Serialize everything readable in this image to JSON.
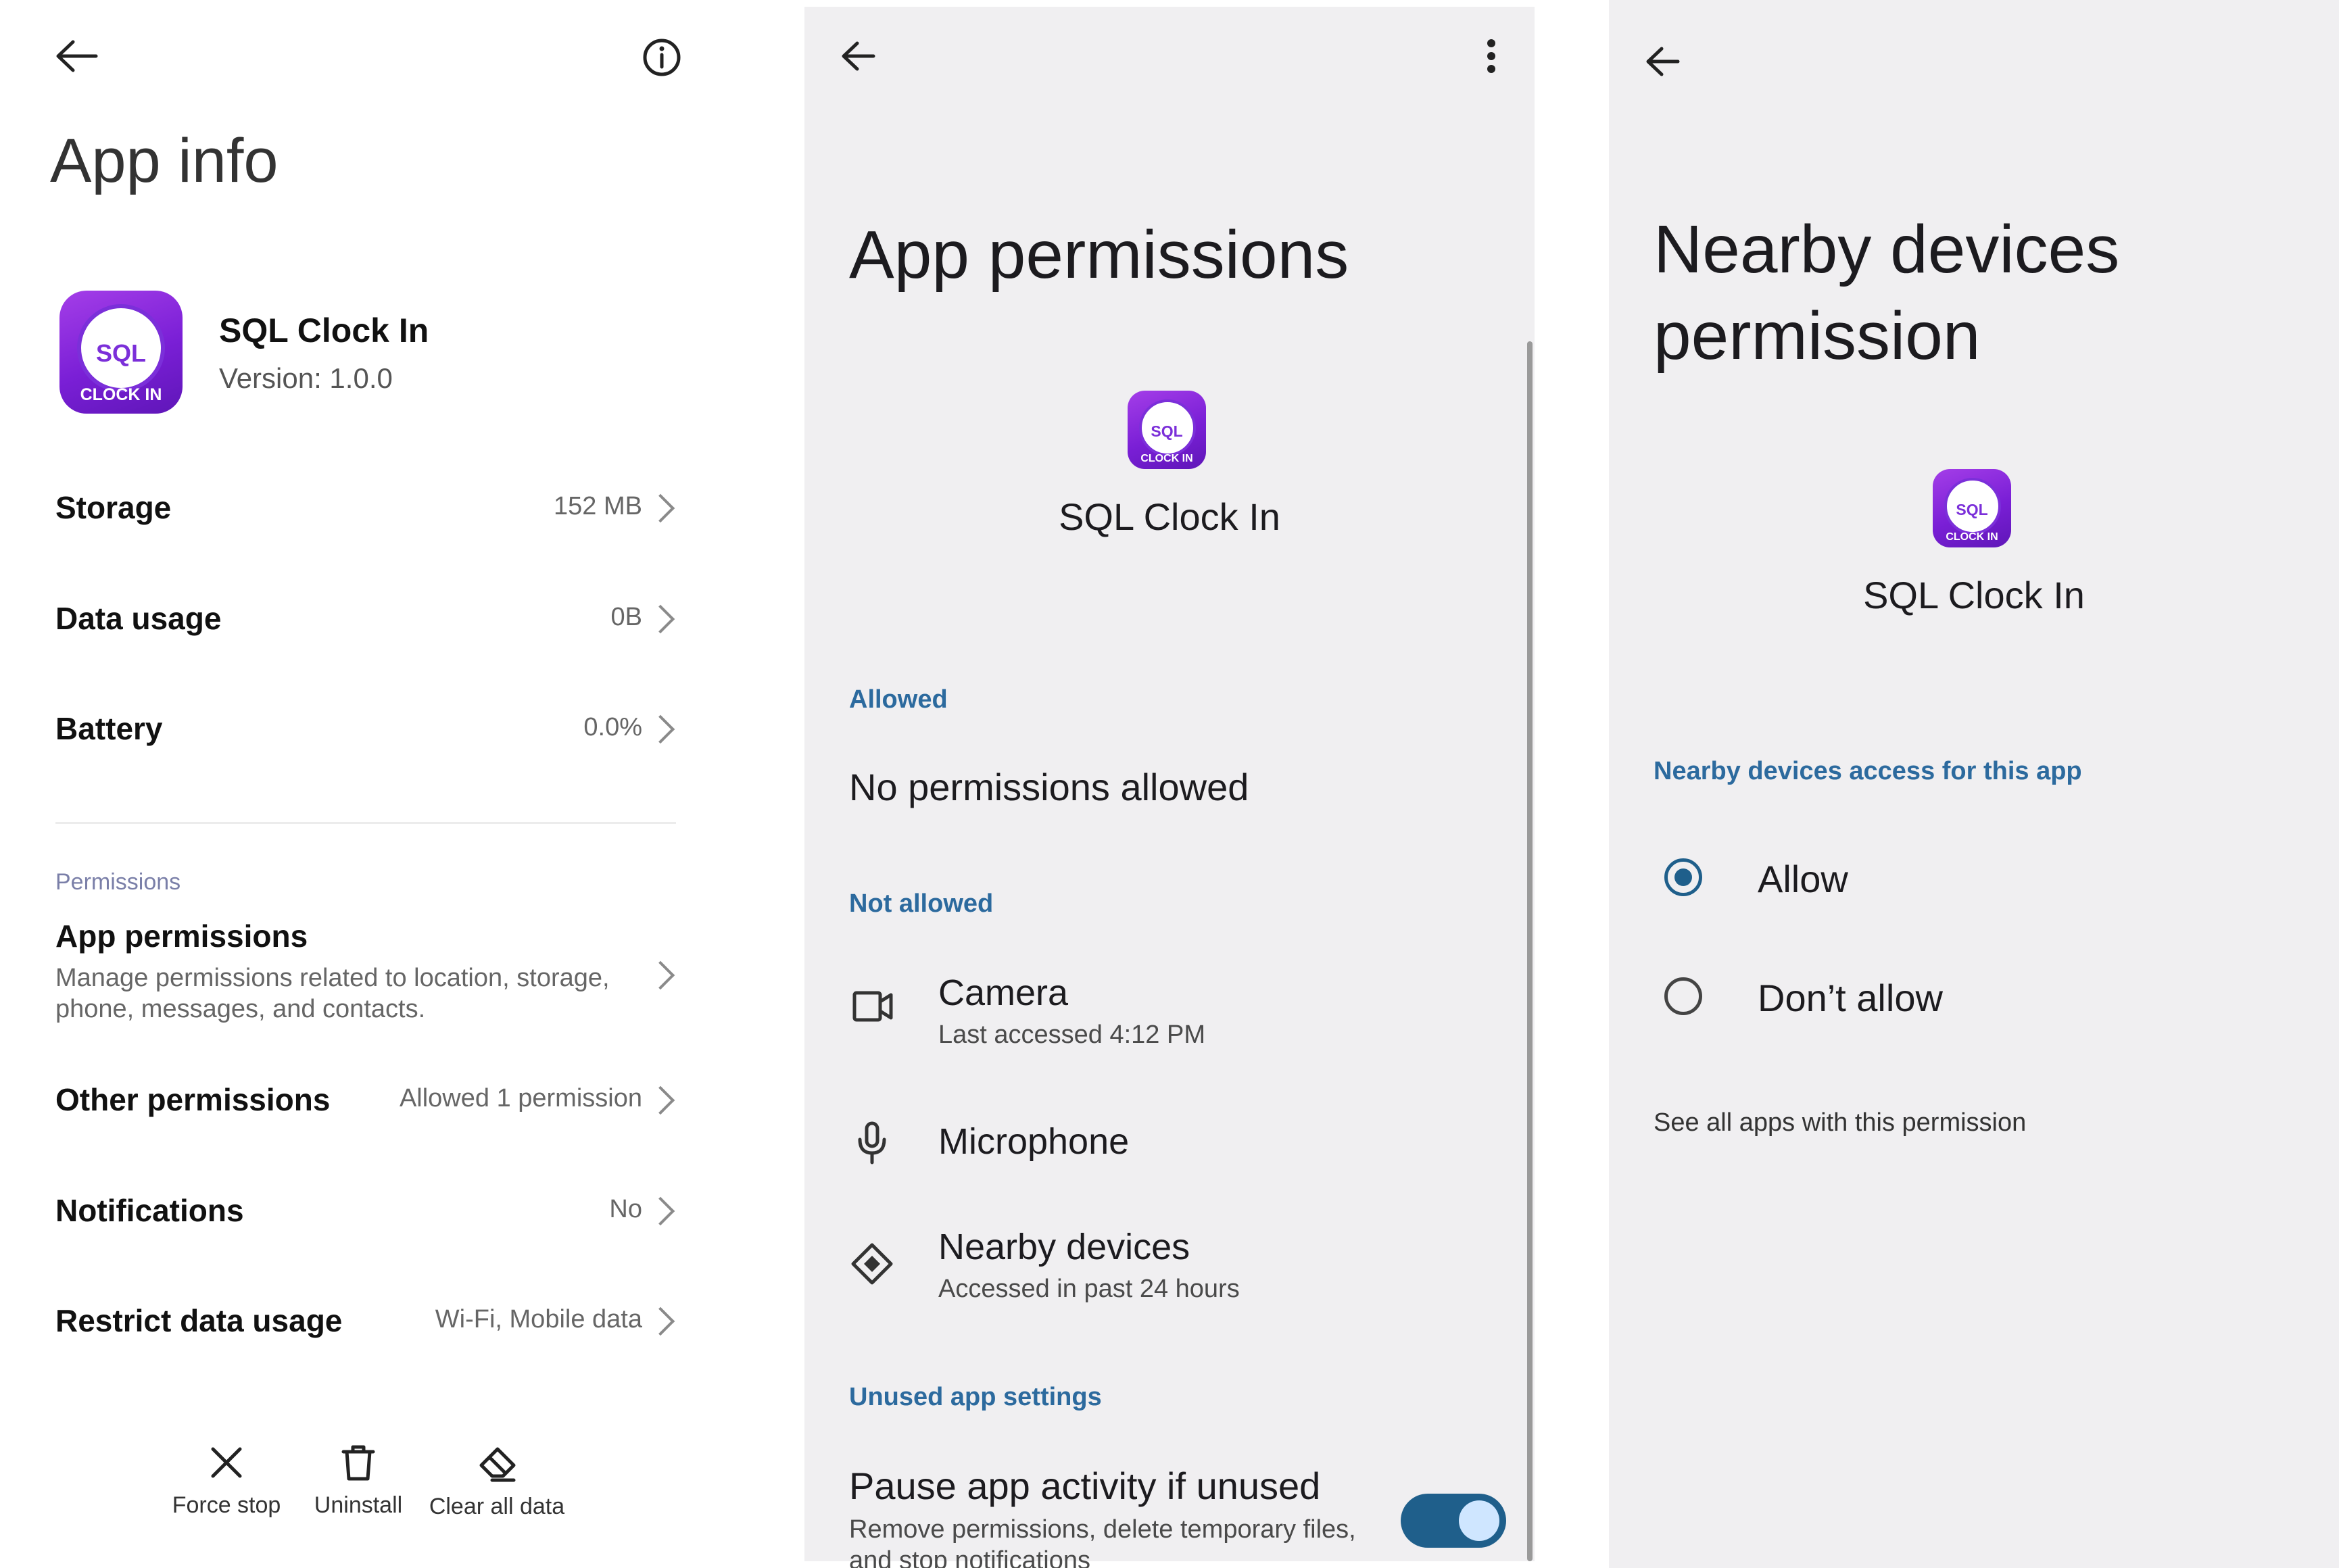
{
  "panel1": {
    "back_icon": "arrow-left-icon",
    "info_icon": "info-circle-icon",
    "title": "App info",
    "app": {
      "name": "SQL Clock In",
      "version": "Version: 1.0.0",
      "icon_top": "SQL",
      "icon_bottom": "CLOCK IN"
    },
    "rows": [
      {
        "label": "Storage",
        "value": "152 MB"
      },
      {
        "label": "Data usage",
        "value": "0B"
      },
      {
        "label": "Battery",
        "value": "0.0%"
      }
    ],
    "permissions_header": "Permissions",
    "app_permissions": {
      "label": "App permissions",
      "desc_line1": "Manage permissions related to location, storage,",
      "desc_line2": "phone, messages, and contacts."
    },
    "rows2": [
      {
        "label": "Other permissions",
        "value": "Allowed 1 permission"
      },
      {
        "label": "Notifications",
        "value": "No"
      },
      {
        "label": "Restrict data usage",
        "value": "Wi-Fi, Mobile data"
      }
    ],
    "actions": [
      {
        "label": "Force stop",
        "icon": "close-x-icon"
      },
      {
        "label": "Uninstall",
        "icon": "trash-icon"
      },
      {
        "label": "Clear all data",
        "icon": "eraser-icon"
      }
    ]
  },
  "panel2": {
    "back_icon": "arrow-left-icon",
    "menu_icon": "more-vertical-icon",
    "title": "App permissions",
    "app_name": "SQL Clock In",
    "allowed_header": "Allowed",
    "allowed_empty": "No permissions allowed",
    "not_allowed_header": "Not allowed",
    "items": [
      {
        "title": "Camera",
        "sub": "Last accessed 4:12 PM",
        "icon": "camera-icon"
      },
      {
        "title": "Microphone",
        "sub": "",
        "icon": "microphone-icon"
      },
      {
        "title": "Nearby devices",
        "sub": "Accessed in past 24 hours",
        "icon": "nearby-devices-icon"
      }
    ],
    "unused_header": "Unused app settings",
    "pause": {
      "title": "Pause app activity if unused",
      "sub1": "Remove permissions, delete temporary files,",
      "sub2": "and stop notifications",
      "toggle_on": true
    }
  },
  "panel3": {
    "back_icon": "arrow-left-icon",
    "title_line1": "Nearby devices",
    "title_line2": "permission",
    "app_name": "SQL Clock In",
    "access_header": "Nearby devices access for this app",
    "options": [
      {
        "label": "Allow",
        "selected": true
      },
      {
        "label": "Don’t allow",
        "selected": false
      }
    ],
    "see_all": "See all apps with this permission"
  },
  "colors": {
    "accent": "#2c6a9e",
    "toggle_track": "#1f5f8b",
    "toggle_thumb": "#cfe6ff",
    "icon_purple": "#7b2fd9",
    "panel_bg": "#f0eff1"
  }
}
